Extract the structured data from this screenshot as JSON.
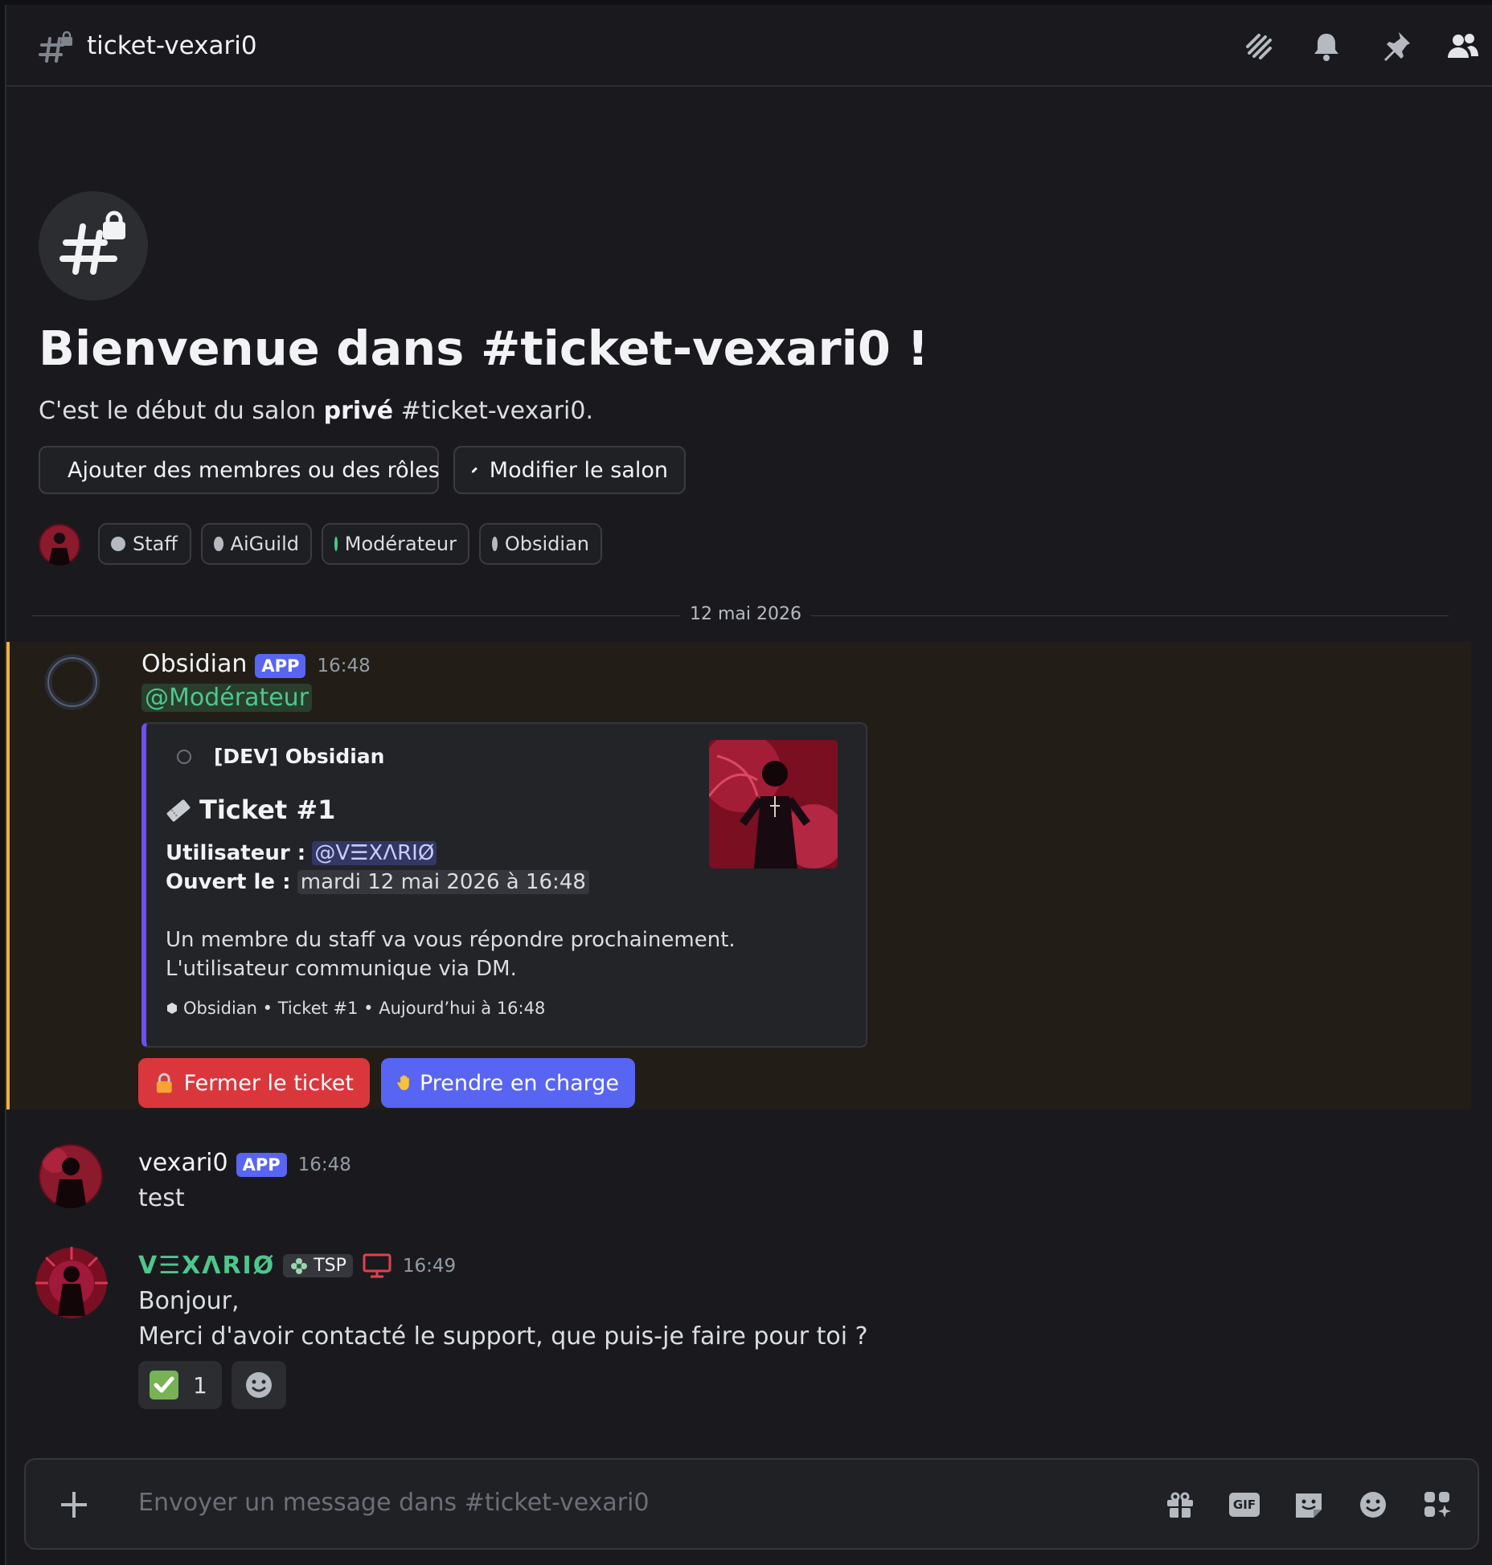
{
  "header": {
    "channel_name": "ticket-vexari0"
  },
  "welcome": {
    "title": "Bienvenue dans #ticket-vexari0 !",
    "subtitle_prefix": "C'est le début du salon ",
    "subtitle_bold": "privé",
    "subtitle_suffix": " #ticket-vexari0.",
    "buttons": {
      "add_members": "Ajouter des membres ou des rôles",
      "edit_channel": "Modifier le salon"
    },
    "roles": [
      {
        "name": "Staff",
        "color": "#b5bac1"
      },
      {
        "name": "AiGuild",
        "color": "#b5bac1"
      },
      {
        "name": "Modérateur",
        "color": "#4ec78d"
      },
      {
        "name": "Obsidian",
        "color": "#b5bac1"
      }
    ]
  },
  "date_divider": "12 mai 2026",
  "messages": [
    {
      "author": "Obsidian",
      "tag": "APP",
      "time": "16:48",
      "mention": "@Modérateur",
      "embed": {
        "author": "[DEV] Obsidian",
        "title": "Ticket #1",
        "user_label": "Utilisateur :",
        "user_value": "@V☰XΛRIØ",
        "opened_label": "Ouvert le :",
        "opened_value": "mardi 12 mai 2026 à 16:48",
        "line1": "Un membre du staff va vous répondre prochainement.",
        "line2": "L'utilisateur communique via DM.",
        "footer": "Obsidian • Ticket #1 • Aujourd’hui à 16:48"
      },
      "buttons": {
        "close": "Fermer le ticket",
        "claim": "Prendre en charge"
      }
    },
    {
      "author": "vexari0",
      "tag": "APP",
      "time": "16:48",
      "text": "test"
    },
    {
      "author": "V☰XΛRIØ",
      "badge": "TSP",
      "time": "16:49",
      "line1": "Bonjour,",
      "line2": "Merci d'avoir contacté le support, que puis-je faire pour toi ?",
      "reaction_count": "1"
    }
  ],
  "composer": {
    "placeholder": "Envoyer un message dans #ticket-vexari0",
    "gif_label": "GIF"
  },
  "colors": {
    "accent": "#5865f2",
    "danger": "#da373c",
    "mention": "#4ec78d",
    "highlight_bar": "#f0b232",
    "embed_bar": "#6d4ff5"
  }
}
